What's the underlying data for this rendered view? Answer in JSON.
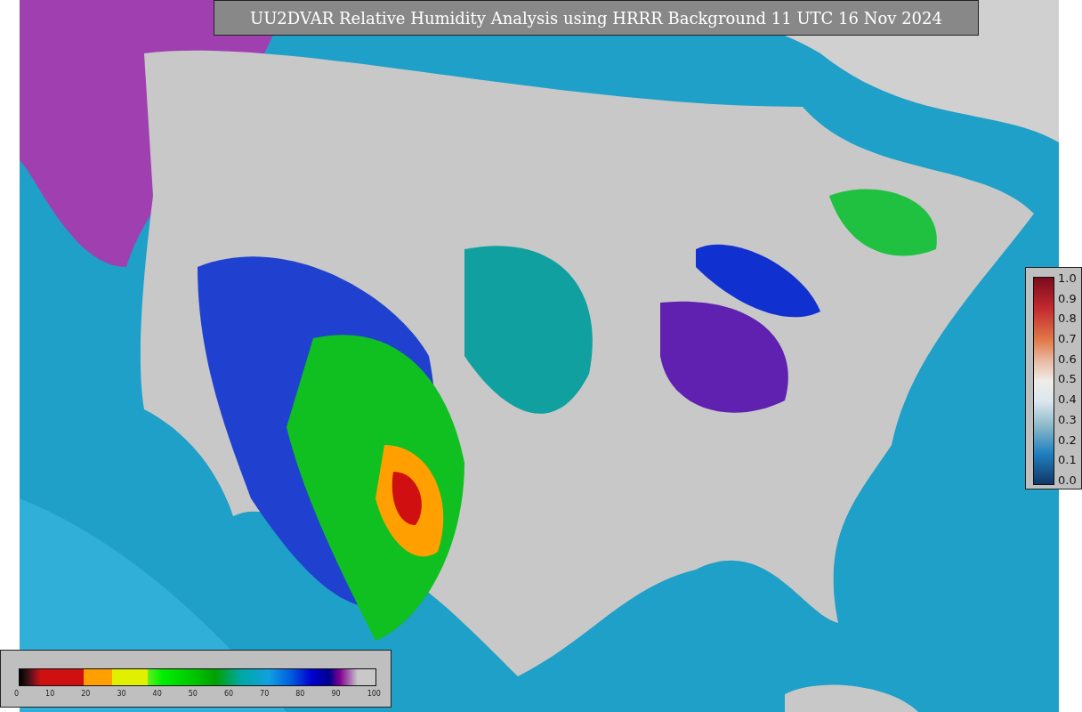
{
  "title": "UU2DVAR Relative Humidity Analysis using HRRR Background 11 UTC 16 Nov 2024",
  "humidity_scale": {
    "ticks": [
      "0",
      "10",
      "20",
      "30",
      "40",
      "50",
      "60",
      "70",
      "80",
      "90",
      "100"
    ]
  },
  "observation_scale": {
    "ticks": [
      "1.0",
      "0.9",
      "0.8",
      "0.7",
      "0.6",
      "0.5",
      "0.4",
      "0.3",
      "0.2",
      "0.1",
      "0.0"
    ]
  }
}
